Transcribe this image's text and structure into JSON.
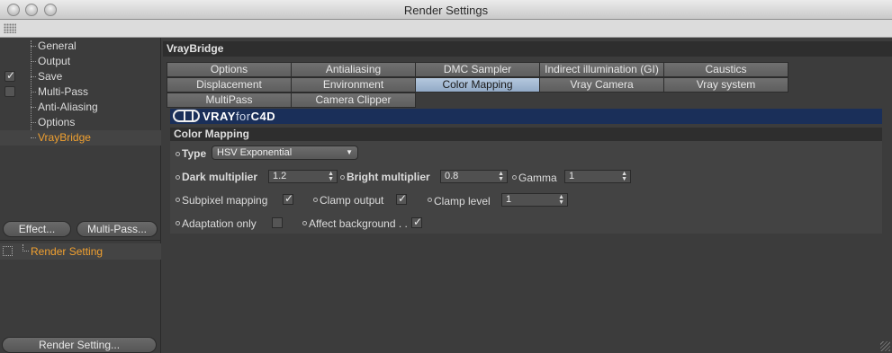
{
  "window": {
    "title": "Render Settings"
  },
  "sidebar": {
    "items": [
      {
        "label": "General",
        "checked": null
      },
      {
        "label": "Output",
        "checked": null
      },
      {
        "label": "Save",
        "checked": true
      },
      {
        "label": "Multi-Pass",
        "checked": false
      },
      {
        "label": "Anti-Aliasing",
        "checked": null
      },
      {
        "label": "Options",
        "checked": null
      },
      {
        "label": "VrayBridge",
        "checked": null,
        "active": true
      }
    ],
    "effect_button": "Effect...",
    "multipass_button": "Multi-Pass...",
    "render_setting_item": "Render Setting",
    "render_setting_button": "Render Setting..."
  },
  "main": {
    "header": "VrayBridge",
    "tabs": [
      {
        "label": "Options"
      },
      {
        "label": "Antialiasing"
      },
      {
        "label": "DMC Sampler"
      },
      {
        "label": "Indirect illumination (GI)"
      },
      {
        "label": "Caustics"
      },
      {
        "label": "Displacement"
      },
      {
        "label": "Environment"
      },
      {
        "label": "Color Mapping",
        "selected": true
      },
      {
        "label": "Vray Camera"
      },
      {
        "label": "Vray system"
      },
      {
        "label": "MultiPass"
      },
      {
        "label": "Camera Clipper"
      }
    ],
    "banner": {
      "logo_main": "VRAY",
      "logo_for": "for",
      "logo_c4d": "C4D"
    },
    "section_title": "Color Mapping",
    "type": {
      "label": "Type",
      "value": "HSV Exponential"
    },
    "dark_multiplier": {
      "label": "Dark multiplier",
      "value": "1.2"
    },
    "bright_multiplier": {
      "label": "Bright multiplier",
      "value": "0.8"
    },
    "gamma": {
      "label": "Gamma",
      "value": "1"
    },
    "subpixel_mapping": {
      "label": "Subpixel mapping",
      "checked": true
    },
    "clamp_output": {
      "label": "Clamp output",
      "checked": true
    },
    "clamp_level": {
      "label": "Clamp level",
      "value": "1"
    },
    "adaptation_only": {
      "label": "Adaptation only",
      "checked": false
    },
    "affect_background": {
      "label": "Affect background . .",
      "checked": true
    }
  },
  "colors": {
    "accent": "#f0a030",
    "selected_tab": "#a3b9d3",
    "banner": "#1a2f59"
  }
}
